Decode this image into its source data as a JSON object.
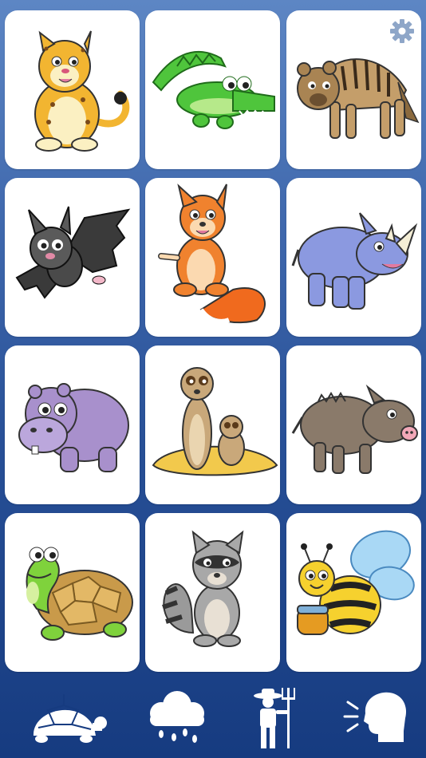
{
  "colors": {
    "background_top": "#5d86c4",
    "background_bottom": "#163b80",
    "card": "#ffffff",
    "toolbar_icon": "#ffffff",
    "settings_gear": "#8ea6c8"
  },
  "settings": {
    "icon": "gear-icon"
  },
  "animals": [
    {
      "name": "Jaguar",
      "icon": "jaguar"
    },
    {
      "name": "Crocodile",
      "icon": "crocodile"
    },
    {
      "name": "Hyena",
      "icon": "hyena"
    },
    {
      "name": "Bat",
      "icon": "bat"
    },
    {
      "name": "Fox",
      "icon": "fox"
    },
    {
      "name": "Rhinoceros",
      "icon": "rhinoceros"
    },
    {
      "name": "Hippopotamus",
      "icon": "hippopotamus"
    },
    {
      "name": "Meerkat",
      "icon": "meerkat"
    },
    {
      "name": "Wild boar",
      "icon": "wild-boar"
    },
    {
      "name": "Turtle",
      "icon": "turtle"
    },
    {
      "name": "Raccoon",
      "icon": "raccoon"
    },
    {
      "name": "Bee",
      "icon": "bee"
    }
  ],
  "toolbar": [
    {
      "icon": "turtle-icon"
    },
    {
      "icon": "rain-cloud-icon"
    },
    {
      "icon": "farmer-icon"
    },
    {
      "icon": "speaking-head-icon"
    }
  ]
}
